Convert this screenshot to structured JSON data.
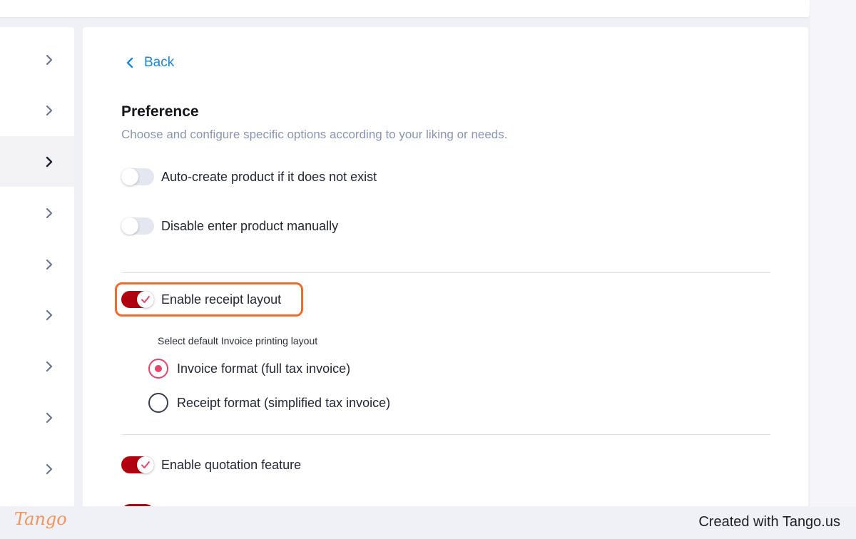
{
  "header": {
    "back_label": "Back"
  },
  "preference": {
    "title": "Preference",
    "subtitle": "Choose and configure specific options according to your liking or needs.",
    "toggles": [
      {
        "label": "Auto-create product if it does not exist",
        "on": false
      },
      {
        "label": "Disable enter product manually",
        "on": false
      },
      {
        "label": "Enable receipt layout",
        "on": true
      },
      {
        "label": "Enable quotation feature",
        "on": true
      }
    ],
    "layout_select": {
      "label": "Select default Invoice printing layout",
      "options": [
        {
          "label": "Invoice format (full tax invoice)",
          "checked": true
        },
        {
          "label": "Receipt format (simplified tax invoice)",
          "checked": false
        }
      ]
    }
  },
  "colors": {
    "accent_link": "#1f86d1",
    "toggle_on": "#b1000e",
    "radio_checked": "#e8436a",
    "highlight_border": "#f26a2e",
    "subtitle": "#8b95b3"
  },
  "footer": {
    "logo_text": "Tango",
    "credit": "Created with Tango.us"
  }
}
